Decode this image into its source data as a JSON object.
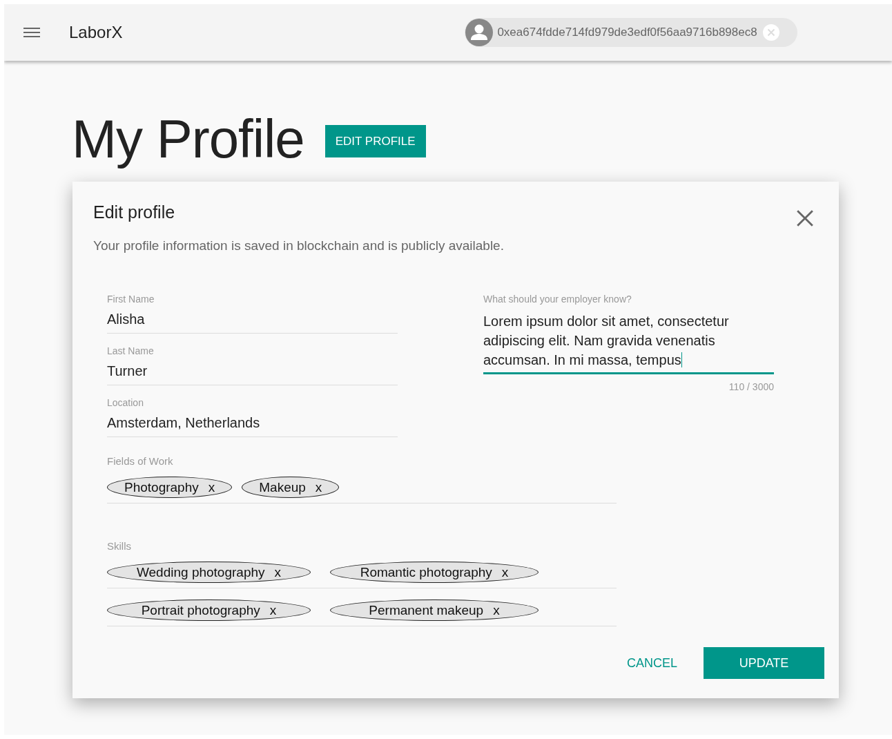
{
  "header": {
    "app_name": "LaborX",
    "account": {
      "address": "0xea674fdde714fd979de3edf0f56aa9716b898ec8"
    }
  },
  "page_title": "My Profile",
  "edit_button": "EDIT PROFILE",
  "dialog": {
    "title": "Edit profile",
    "subtitle": "Your profile information is saved in blockchain and is publicly available.",
    "fields": [
      {
        "label": "First Name",
        "value": "Alisha"
      },
      {
        "label": "Last Name",
        "value": "Turner"
      },
      {
        "label": "Location",
        "value": "Amsterdam, Netherlands"
      }
    ],
    "about": {
      "label": "What should your employer know?",
      "value": "Lorem ipsum dolor sit amet, consectetur adipiscing elit. Nam gravida venenatis accumsan. In mi massa, tempus",
      "counter": "110 / 3000",
      "focused": true
    },
    "fields_of_work": {
      "label": "Fields of Work",
      "rows": [
        [
          {
            "label": "Photography",
            "remove": "x"
          },
          {
            "label": "Makeup",
            "remove": "x"
          }
        ]
      ]
    },
    "skills": {
      "label": "Skills",
      "rows": [
        [
          {
            "label": "Wedding photography",
            "remove": "x"
          },
          {
            "label": "Romantic photography",
            "remove": "x"
          }
        ],
        [
          {
            "label": "Portrait photography",
            "remove": "x"
          },
          {
            "label": "Permanent makeup",
            "remove": "x"
          }
        ]
      ]
    },
    "buttons": {
      "cancel": "CANCEL",
      "update": "UPDATE"
    }
  }
}
